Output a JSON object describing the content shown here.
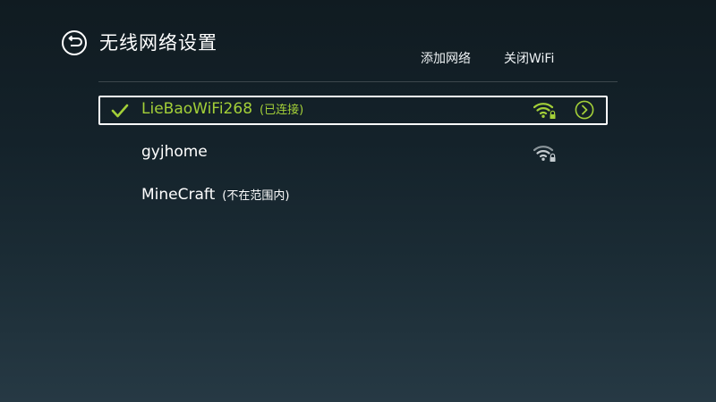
{
  "header": {
    "title": "无线网络设置",
    "add_network_label": "添加网络",
    "close_wifi_label": "关闭WiFi"
  },
  "networks": [
    {
      "ssid": "LieBaoWiFi268",
      "status": "(已连接)",
      "connected": true,
      "signal_bars": 3,
      "secured": true
    },
    {
      "ssid": "gyjhome",
      "status": "",
      "connected": false,
      "signal_bars": 2,
      "secured": true
    },
    {
      "ssid": "MineCraft",
      "status": "(不在范围内)",
      "connected": false,
      "signal_bars": 0,
      "secured": false
    }
  ],
  "colors": {
    "accent_green": "#a3cf38",
    "text_white": "#ffffff",
    "signal_dim": "#8c969b"
  },
  "icons": {
    "back": "back-arrow-circle-icon",
    "connected": "checkmark-icon",
    "signal": "wifi-signal-icon",
    "lock": "lock-icon",
    "detail": "chevron-right-circle-icon"
  }
}
